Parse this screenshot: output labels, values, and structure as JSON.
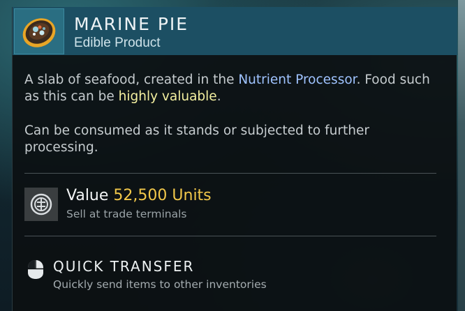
{
  "item": {
    "title": "MARINE PIE",
    "category": "Edible Product",
    "icon": "marine-pie-icon"
  },
  "description": {
    "part1": "A slab of seafood, created in the ",
    "link": "Nutrient Processor",
    "part2": ". Food such as this can be ",
    "highlight": "highly valuable",
    "part3": ".",
    "paragraph2": "Can be consumed as it stands or subjected to further processing."
  },
  "value": {
    "label": "Value",
    "amount": "52,500 Units",
    "note": "Sell at trade terminals",
    "icon": "units-currency-icon"
  },
  "quick_transfer": {
    "label": "QUICK TRANSFER",
    "note": "Quickly send items to other inventories",
    "icon": "mouse-button-icon"
  },
  "colors": {
    "header": "#1c4f63",
    "link": "#9fc3ff",
    "highlight": "#f4f0a0",
    "value": "#f2c84a"
  }
}
